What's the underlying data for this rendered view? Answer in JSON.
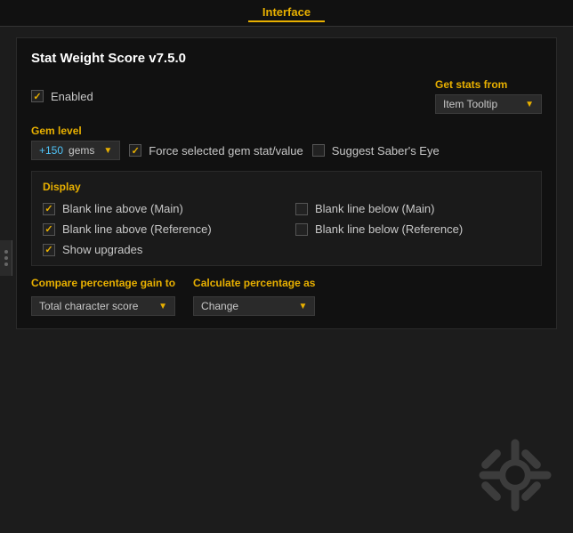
{
  "header": {
    "tab_label": "Interface"
  },
  "panel": {
    "title": "Stat Weight Score v7.5.0",
    "enabled_label": "Enabled",
    "get_stats_label": "Get stats from",
    "get_stats_value": "Item Tooltip",
    "gem_level_label": "Gem level",
    "gem_level_value": "+150",
    "gem_level_unit": "gems",
    "force_gem_label": "Force selected gem stat/value",
    "suggest_eye_label": "Suggest Saber's Eye",
    "display": {
      "header": "Display",
      "items": [
        {
          "id": "blank-above-main",
          "label": "Blank line above (Main)",
          "checked": true
        },
        {
          "id": "blank-below-main",
          "label": "Blank line below (Main)",
          "checked": false
        },
        {
          "id": "blank-above-ref",
          "label": "Blank line above (Reference)",
          "checked": true
        },
        {
          "id": "blank-below-ref",
          "label": "Blank line below (Reference)",
          "checked": false
        }
      ],
      "show_upgrades_label": "Show upgrades",
      "show_upgrades_checked": true
    },
    "compare": {
      "label": "Compare percentage gain to",
      "value": "Total character score"
    },
    "calculate": {
      "label": "Calculate percentage as",
      "value": "Change"
    }
  }
}
